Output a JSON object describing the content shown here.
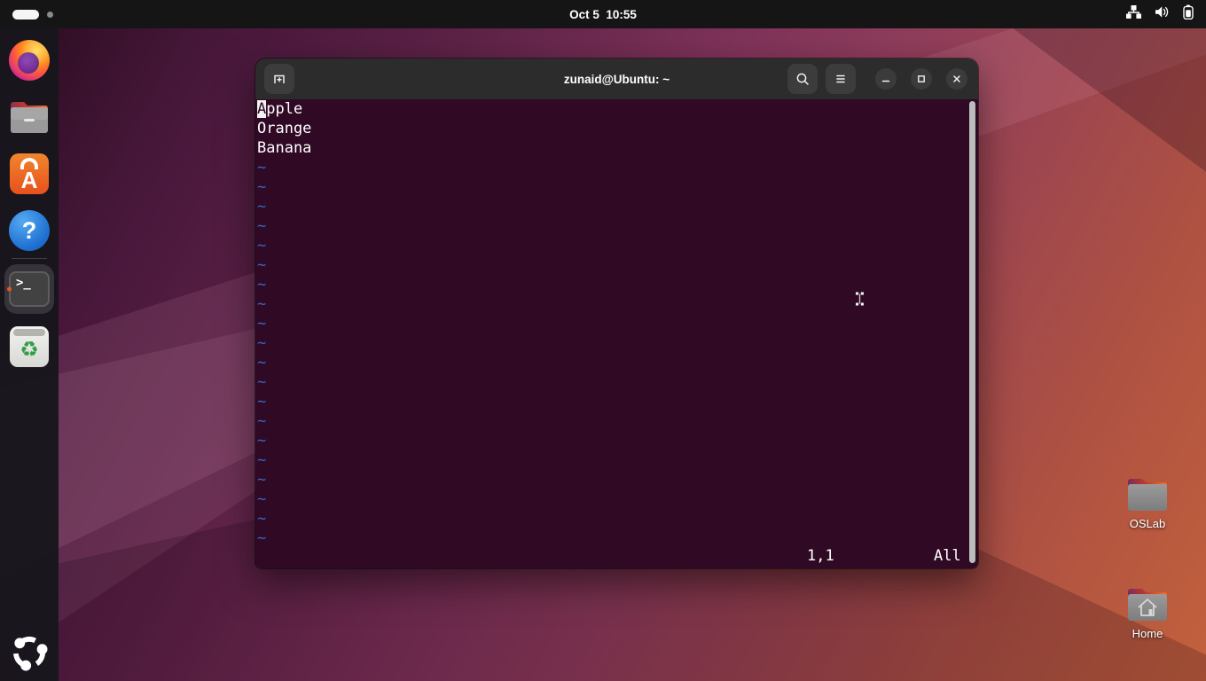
{
  "topbar": {
    "clock": "Oct 5  10:55",
    "tray_icons": [
      "network-icon",
      "volume-icon",
      "battery-icon"
    ]
  },
  "dock": {
    "items": [
      "firefox",
      "files",
      "ubuntu-software",
      "help",
      "terminal",
      "trash"
    ],
    "active_item": "terminal",
    "show_apps": "ubuntu-logo",
    "terminal_glyph": ">_",
    "recycle_glyph": "♻",
    "software_letter": "A",
    "help_glyph": "?"
  },
  "window": {
    "title": "zunaid@Ubuntu: ~",
    "controls": [
      "new-tab",
      "search",
      "menu",
      "minimize",
      "maximize",
      "close"
    ]
  },
  "terminal": {
    "line1": {
      "cursor_char": "A",
      "rest": "pple"
    },
    "line2": "Orange",
    "line3": "Banana",
    "tilde": "~",
    "tilde_count": 20,
    "ruler": "1,1",
    "scroll_position": "All"
  },
  "desktop_icons": [
    {
      "label": "OSLab"
    },
    {
      "label": "Home"
    }
  ],
  "colors": {
    "terminal_bg": "#300a24",
    "titlebar": "#2c2c2c",
    "tilde_blue": "#3566c4",
    "ubuntu_orange": "#e95420",
    "wallpaper_purple": "#7c3158",
    "wallpaper_red": "#c2613c"
  }
}
